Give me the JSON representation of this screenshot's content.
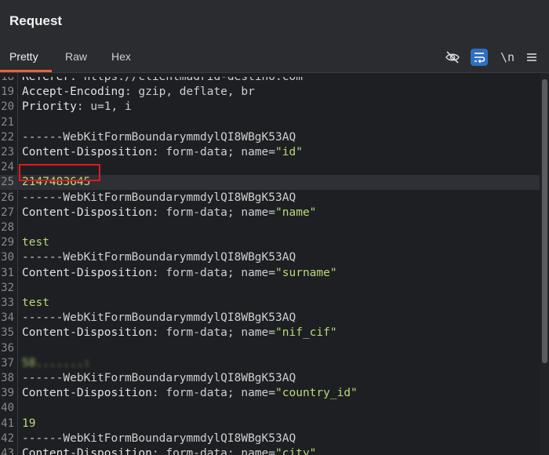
{
  "panel": {
    "title": "Request",
    "tabs": [
      {
        "label": "Pretty",
        "active": true
      },
      {
        "label": "Raw",
        "active": false
      },
      {
        "label": "Hex",
        "active": false
      }
    ],
    "toolbar": {
      "hide_icon": "eye-slash-icon",
      "wrap_icon": "word-wrap-icon",
      "newline_label": "\\n",
      "menu_icon": "hamburger-menu-icon"
    }
  },
  "editor": {
    "lines": [
      {
        "n": "18",
        "name": "Referer",
        "value": "https://clientmadrid-destino.com",
        "clipped": true
      },
      {
        "n": "19",
        "name": "Accept-Encoding",
        "value": "gzip, deflate, br"
      },
      {
        "n": "20",
        "name": "Priority",
        "value": "u=1, i"
      },
      {
        "n": "21",
        "text": ""
      },
      {
        "n": "22",
        "boundary": "------WebKitFormBoundarymmdylQI8WBgK53AQ"
      },
      {
        "n": "23",
        "name": "Content-Disposition",
        "pre": "form-data; name=",
        "str": "\"id\""
      },
      {
        "n": "24",
        "text": ""
      },
      {
        "n": "25",
        "body": "2147483645",
        "highlight": true
      },
      {
        "n": "26",
        "boundary": "------WebKitFormBoundarymmdylQI8WBgK53AQ"
      },
      {
        "n": "27",
        "name": "Content-Disposition",
        "pre": "form-data; name=",
        "str": "\"name\""
      },
      {
        "n": "28",
        "text": ""
      },
      {
        "n": "29",
        "body": "test"
      },
      {
        "n": "30",
        "boundary": "------WebKitFormBoundarymmdylQI8WBgK53AQ"
      },
      {
        "n": "31",
        "name": "Content-Disposition",
        "pre": "form-data; name=",
        "str": "\"surname\""
      },
      {
        "n": "32",
        "text": ""
      },
      {
        "n": "33",
        "body": "test"
      },
      {
        "n": "34",
        "boundary": "------WebKitFormBoundarymmdylQI8WBgK53AQ"
      },
      {
        "n": "35",
        "name": "Content-Disposition",
        "pre": "form-data; name=",
        "str": "\"nif_cif\""
      },
      {
        "n": "36",
        "text": ""
      },
      {
        "n": "37",
        "blurred": "58.......:"
      },
      {
        "n": "38",
        "boundary": "------WebKitFormBoundarymmdylQI8WBgK53AQ"
      },
      {
        "n": "39",
        "name": "Content-Disposition",
        "pre": "form-data; name=",
        "str": "\"country_id\""
      },
      {
        "n": "40",
        "text": ""
      },
      {
        "n": "41",
        "body": "19"
      },
      {
        "n": "42",
        "boundary": "------WebKitFormBoundarymmdylQI8WBgK53AQ"
      },
      {
        "n": "43",
        "name": "Content-Disposition",
        "pre": "form-data; name=",
        "str": "\"city\""
      }
    ]
  }
}
